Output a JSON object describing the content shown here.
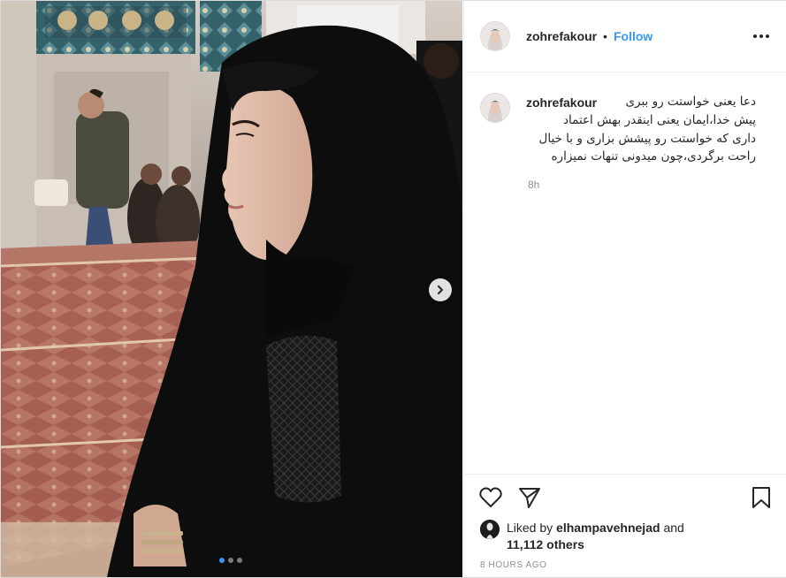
{
  "post": {
    "username": "zohrefakour",
    "separator": "•",
    "follow_label": "Follow",
    "more_icon": "more-options-icon",
    "carousel_total": 3,
    "carousel_active": 1
  },
  "caption": {
    "username": "zohrefakour",
    "lines": [
      "دعا یعنی خواستت رو ببری",
      "پیش خدا،ایمان یعنی اینقدر بهش اعتماد",
      "داری که خواستت رو پیشش بزاری و با خیال",
      "راحت برگردی،چون میدونی تنهات نمیزاره"
    ],
    "time_ago": "8h"
  },
  "actions": {
    "like_icon": "heart-icon",
    "share_icon": "paper-plane-icon",
    "save_icon": "bookmark-icon"
  },
  "likes": {
    "prefix": "Liked by",
    "user": "elhampavehnejad",
    "conjunction": "and",
    "others": "11,112 others"
  },
  "timestamp": "8 HOURS AGO",
  "colors": {
    "link_blue": "#3897f0",
    "text": "#262626",
    "muted": "#8e8e8e",
    "border": "#dbdbdb"
  }
}
